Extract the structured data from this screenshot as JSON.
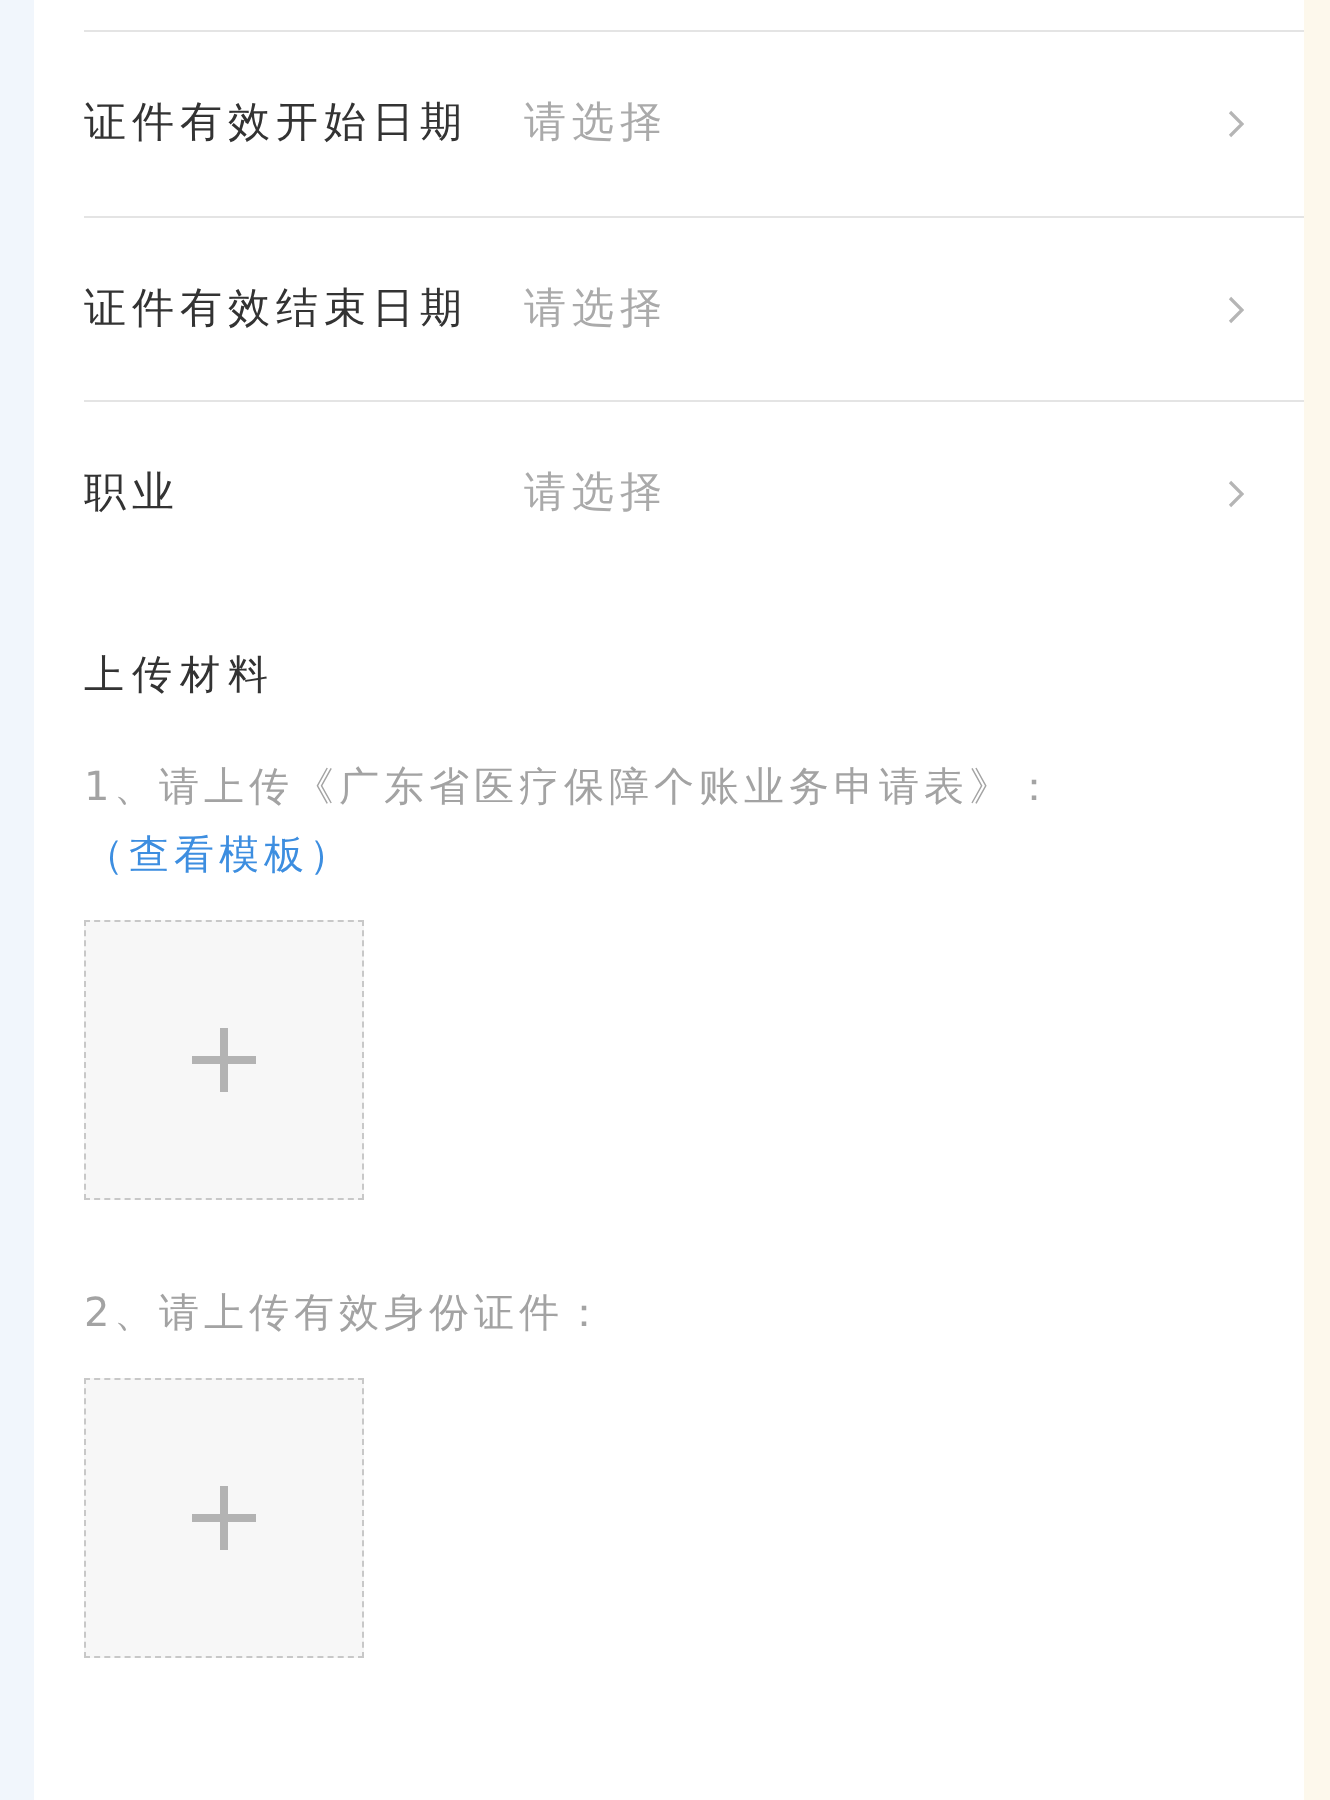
{
  "rows": [
    {
      "label": "证件有效开始日期",
      "placeholder": "请选择"
    },
    {
      "label": "证件有效结束日期",
      "placeholder": "请选择"
    },
    {
      "label": "职业",
      "placeholder": "请选择"
    }
  ],
  "upload": {
    "title": "上传材料",
    "items": [
      {
        "text": "1、请上传《广东省医疗保障个账业务申请表》：",
        "link": "（查看模板）"
      },
      {
        "text": "2、请上传有效身份证件："
      }
    ]
  }
}
